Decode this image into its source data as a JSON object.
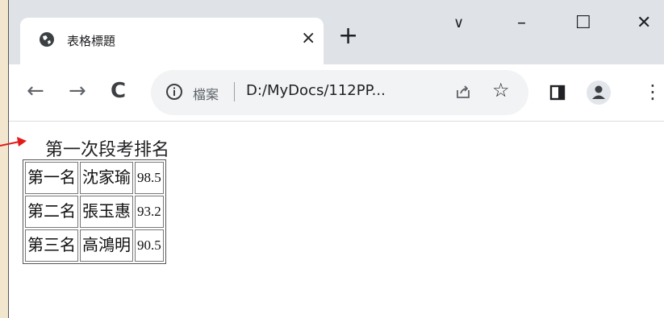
{
  "tab": {
    "title": "表格標題",
    "close_glyph": "×"
  },
  "newtab_glyph": "+",
  "window_controls": {
    "chevron": "∨",
    "minimize": "–",
    "maximize": "☐",
    "close": "✕"
  },
  "nav": {
    "back": "←",
    "forward": "→",
    "reload": "C"
  },
  "omnibox": {
    "label": "檔案",
    "url": "D:/MyDocs/112PP..."
  },
  "star_glyph": "☆",
  "menu_glyph": "⋮",
  "page": {
    "caption": "第一次段考排名",
    "rows": [
      {
        "rank": "第一名",
        "name": "沈家瑜",
        "score": "98.5"
      },
      {
        "rank": "第二名",
        "name": "張玉惠",
        "score": "93.2"
      },
      {
        "rank": "第三名",
        "name": "高鴻明",
        "score": "90.5"
      }
    ]
  },
  "colors": {
    "annotation_arrow": "#e11b1b",
    "titlebar": "#dfe3e8",
    "omnibox": "#f1f3f4",
    "backdrop": "#f3e6cf"
  }
}
